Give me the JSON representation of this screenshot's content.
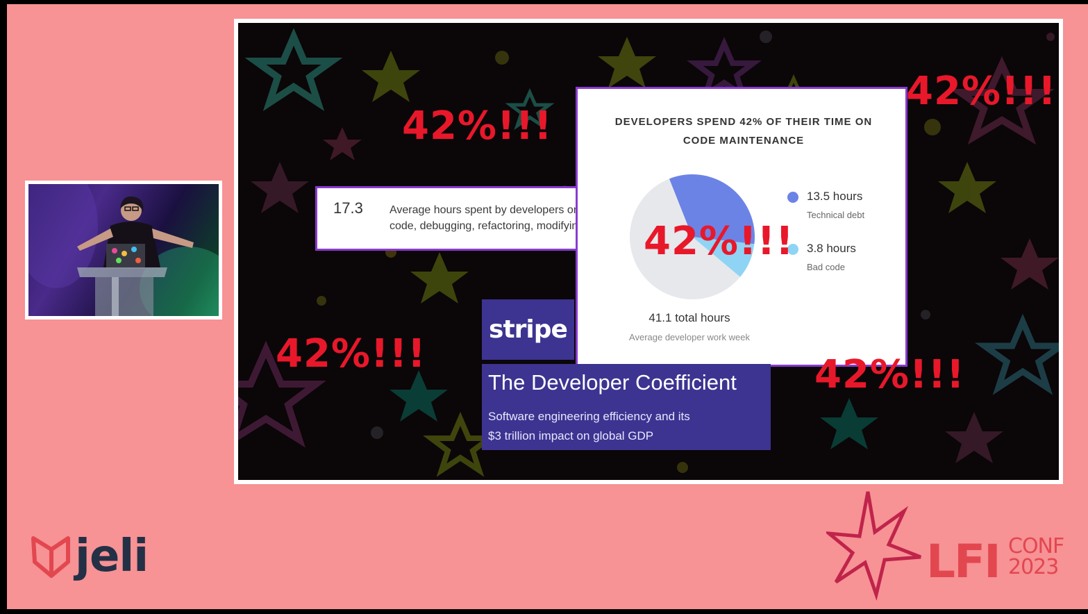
{
  "webcam": {
    "description_icon": "speaker-at-podium"
  },
  "slide": {
    "emphasis_text": "42%!!!",
    "stat_card": {
      "value": "17.3",
      "description": "Average hours spent by developers on bad code, debugging, refactoring, modifying"
    },
    "chart_card": {
      "title": "DEVELOPERS SPEND 42% OF THEIR TIME ON CODE MAINTENANCE",
      "legend": [
        {
          "value": "13.5 hours",
          "label": "Technical debt",
          "color": "#6c83e6"
        },
        {
          "value": "3.8 hours",
          "label": "Bad code",
          "color": "#8fd4f4"
        }
      ],
      "total_value": "41.1 total hours",
      "total_label": "Average developer work week"
    },
    "brand": {
      "logo_text": "stripe",
      "report_title": "The Developer Coefficient",
      "report_subtitle_line1": "Software engineering efficiency and its",
      "report_subtitle_line2": "$3 trillion impact on global GDP"
    }
  },
  "chart_data": {
    "type": "pie",
    "title": "DEVELOPERS SPEND 42% OF THEIR TIME ON CODE MAINTENANCE",
    "slices": [
      {
        "name": "Technical debt",
        "value": 13.5,
        "color": "#6c83e6"
      },
      {
        "name": "Bad code",
        "value": 3.8,
        "color": "#8fd4f4"
      },
      {
        "name": "",
        "value": 23.8,
        "color": "#e6e8ec"
      }
    ],
    "total": 41.1
  },
  "footer": {
    "jeli_logo_text": "jeli",
    "conf_word": "LFI",
    "conf_label": "CONF",
    "conf_year": "2023"
  },
  "colors": {
    "background": "#f79295",
    "accent_red": "#e8182a",
    "stripe_purple": "#3c3490",
    "card_border": "#8a3ad0"
  }
}
